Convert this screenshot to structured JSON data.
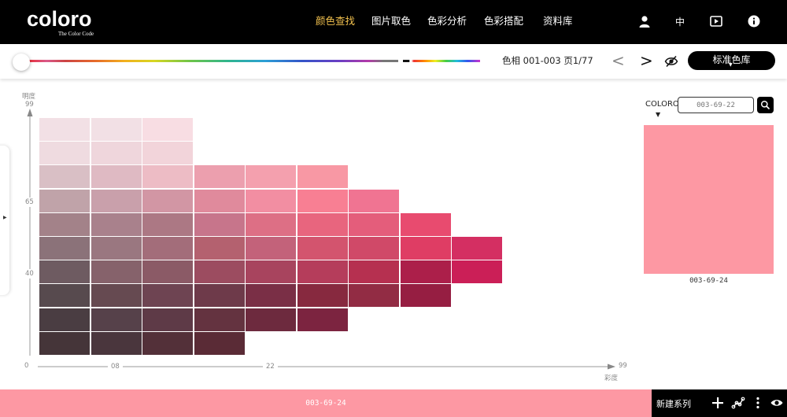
{
  "brand": {
    "logo_text": "coloro",
    "tagline": "The Color Code"
  },
  "nav": {
    "items": [
      {
        "label": "颜色查找",
        "active": true
      },
      {
        "label": "图片取色",
        "active": false
      },
      {
        "label": "色彩分析",
        "active": false
      },
      {
        "label": "色彩搭配",
        "active": false
      },
      {
        "label": "资料库",
        "active": false
      }
    ],
    "language_label": "中",
    "icons": [
      "user-icon",
      "play-icon",
      "info-icon"
    ]
  },
  "toolbar": {
    "hue_label": "色相 001-003 页1/77",
    "prev_symbol": "<",
    "next_symbol": ">",
    "library_label": "标准色库",
    "library_caret": "▼"
  },
  "chart": {
    "y_axis_title": "明度",
    "x_axis_title": "彩度",
    "y_ticks": [
      "99",
      "65",
      "40"
    ],
    "x_ticks": [
      "0",
      "08",
      "22",
      "99"
    ],
    "rows": [
      [
        "#f2e0e5",
        "#f2e0e5",
        "#f8dde3"
      ],
      [
        "#efdbe0",
        "#efd6dc",
        "#f2d4da"
      ],
      [
        "#d9bfc5",
        "#dfbac3",
        "#edbcc5",
        "#ec9fae",
        "#f4a0ae",
        "#f898a4"
      ],
      [
        "#c0a3a9",
        "#c9a0ab",
        "#d296a4",
        "#e08a9c",
        "#f28ea2",
        "#f87f93",
        "#f07492"
      ],
      [
        "#a38289",
        "#a9818c",
        "#ac7884",
        "#c7758b",
        "#dd6f85",
        "#e8657e",
        "#e45d7b",
        "#e84b6f"
      ],
      [
        "#8b7279",
        "#9a7780",
        "#a36d7a",
        "#b4616f",
        "#c3627a",
        "#d3546e",
        "#d04968",
        "#df3d64",
        "#d42f62"
      ],
      [
        "#6e5b61",
        "#86626b",
        "#8b5a66",
        "#9c4c60",
        "#a8445e",
        "#b53d5b",
        "#b63050",
        "#ac1f4a",
        "#cb1f57"
      ],
      [
        "#574a4e",
        "#664a51",
        "#6e4452",
        "#6e3a4a",
        "#7a2f46",
        "#87293f",
        "#922c44",
        "#961e42"
      ],
      [
        "#4a3d42",
        "#56414a",
        "#5e3a47",
        "#643340",
        "#6d2a3e",
        "#7c2440"
      ],
      [
        "#453539",
        "#4a363d",
        "#533039",
        "#5a2b36"
      ]
    ]
  },
  "selection": {
    "brand_label": "COLORO",
    "brand_caret": "▼",
    "search_placeholder": "003-69-22",
    "code": "003-69-24",
    "color": "#fd98a3"
  },
  "bottom": {
    "code": "003-69-24",
    "new_series_label": "新建系列",
    "color": "#fd98a3"
  }
}
